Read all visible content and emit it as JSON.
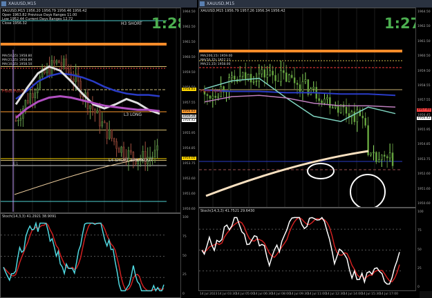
{
  "left": {
    "window_title": "XAUUSD,M15",
    "ohlc_line": "XAUUSD,M15  1956.20 1956.79 1956.46 1956.42",
    "info_lines": [
      "Open  1963.82   Previous Days Ranges 11.00",
      "Low  1952.44   Current Days Ranges 12.72",
      "Close  1956.32"
    ],
    "timer": "1:28",
    "labels": {
      "h3": "H3 SHORT",
      "l3": "L3 LONG",
      "l4": "L4 SHORT BREAKOUT",
      "pivot": "Pivot Point",
      "e1": "E1"
    },
    "ma_legend": [
      "MA(50,15) 1958.80",
      "MA(21,15) 1958.89",
      "MA(10,15) 1958.50"
    ],
    "price_ticks": [
      "1964.50",
      "1962.50",
      "1961.50",
      "1960.50",
      "1959.50",
      "1958.50",
      "1957.55",
      "1956.45",
      "1955.95",
      "1954.85",
      "1953.75",
      "1952.60",
      "1951.60",
      "1950.60"
    ],
    "price_tags": [
      {
        "text": "1958.81",
        "color": "#ffd700"
      },
      {
        "text": "1956.83",
        "color": "#ff9a2e"
      },
      {
        "text": "1956.28",
        "color": "#cccccc"
      },
      {
        "text": "1956.42",
        "color": "#ffffff"
      },
      {
        "text": "1954.05",
        "color": "#ffd700"
      }
    ],
    "stoch_label": "Stoch(14,3,3) 41.2921 38.9091",
    "stoch_ticks": [
      "100",
      "75",
      "50",
      "25",
      "0"
    ]
  },
  "right": {
    "window_title": "XAUUSD,M15",
    "ohlc_line": "XAUUSD,M15  1956.79 1957.26 1956.34 1956.42",
    "timer": "1:27",
    "ma_legend": [
      "MA(200,15) 1959.00",
      "MA(50,15) 1957.11",
      "MA(21,15) 1958.00"
    ],
    "pivot": "Pivot Point",
    "price_ticks": [
      "1964.50",
      "1962.50",
      "1961.50",
      "1960.50",
      "1959.50",
      "1958.55",
      "1957.55",
      "1956.45",
      "1955.95",
      "1954.85",
      "1953.75",
      "1952.60",
      "1951.60",
      "1950.60"
    ],
    "price_tags": [
      {
        "text": "1957.40",
        "color": "#ff4040"
      },
      {
        "text": "1956.42",
        "color": "#ffffff"
      }
    ],
    "time_ticks": [
      "14 Jul 2023",
      "14 Jul 03:30",
      "14 Jul 05:00",
      "14 Jul 06:30",
      "14 Jul 08:00",
      "14 Jul 09:30",
      "14 Jul 11:00",
      "14 Jul 12:30",
      "14 Jul 14:00",
      "14 Jul 15:30",
      "14 Jul 17:00"
    ],
    "stoch_label": "Stoch(14,3,3) 41.7521 29.6430",
    "stoch_ticks": [
      "100",
      "75",
      "50",
      "25",
      "0"
    ]
  },
  "chart_data": [
    {
      "type": "line",
      "title": "XAUUSD,M15",
      "series": [
        {
          "name": "MA(50,15)",
          "color": "#2a3cc8",
          "values": [
            1958.6,
            1959.2,
            1959.9,
            1960.3,
            1960.5,
            1960.4,
            1960.2,
            1959.9,
            1959.5,
            1959.2,
            1959.0,
            1958.9,
            1958.9,
            1958.8
          ]
        },
        {
          "name": "MA(21,15)",
          "color": "#e0e0e0",
          "values": [
            1958.2,
            1959.4,
            1960.5,
            1961.0,
            1960.7,
            1959.9,
            1959.0,
            1958.2,
            1957.9,
            1958.2,
            1958.6,
            1958.3,
            1957.8,
            1957.5
          ]
        },
        {
          "name": "MA(10,15)",
          "color": "#b04fc0",
          "values": [
            1957.2,
            1957.9,
            1958.4,
            1958.7,
            1958.8,
            1958.7,
            1958.5,
            1958.3,
            1958.1,
            1958.0,
            1957.9,
            1957.8,
            1957.8,
            1957.7
          ]
        }
      ],
      "levels": [
        {
          "name": "H3 SHORT",
          "value": 1961.0
        },
        {
          "name": "L3 LONG",
          "value": 1956.3
        },
        {
          "name": "L4 SHORT BREAKOUT",
          "value": 1954.05
        }
      ],
      "ylim": [
        1950.6,
        1964.5
      ]
    },
    {
      "type": "line",
      "title": "XAUUSD,M15",
      "series": [
        {
          "name": "MA(200,15)",
          "color": "#2a3cc8",
          "values": [
            1959.1,
            1959.0,
            1959.0,
            1958.9,
            1958.9,
            1958.8,
            1958.8,
            1958.7
          ]
        },
        {
          "name": "MA(21,15)",
          "color": "#7fd4c0",
          "values": [
            1959.2,
            1959.8,
            1960.0,
            1958.5,
            1957.1,
            1956.7,
            1957.8,
            1957.3
          ]
        },
        {
          "name": "MA(50,15)",
          "color": "#c080c0",
          "values": [
            1958.2,
            1958.6,
            1958.7,
            1958.5,
            1958.1,
            1957.9,
            1957.9,
            1957.8
          ]
        }
      ],
      "ylim": [
        1950.6,
        1964.5
      ]
    }
  ]
}
